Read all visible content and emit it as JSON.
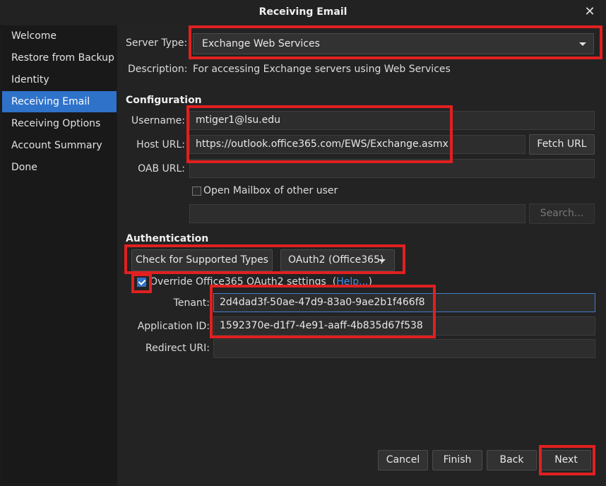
{
  "window": {
    "title": "Receiving Email"
  },
  "sidebar": {
    "items": [
      {
        "label": "Welcome"
      },
      {
        "label": "Restore from Backup"
      },
      {
        "label": "Identity"
      },
      {
        "label": "Receiving Email"
      },
      {
        "label": "Receiving Options"
      },
      {
        "label": "Account Summary"
      },
      {
        "label": "Done"
      }
    ],
    "active_index": 3
  },
  "server": {
    "type_label": "Server Type:",
    "type_value": "Exchange Web Services",
    "description_label": "Description:",
    "description_value": "For accessing Exchange servers using Web Services"
  },
  "configuration": {
    "heading": "Configuration",
    "username_label": "Username:",
    "username_value": "mtiger1@lsu.edu",
    "host_label": "Host URL:",
    "host_value": "https://outlook.office365.com/EWS/Exchange.asmx",
    "fetch_button": "Fetch URL",
    "oab_label": "OAB URL:",
    "oab_value": "",
    "other_mailbox_label": "Open Mailbox of other user",
    "other_mailbox_checked": false,
    "mailbox_value": "",
    "search_button": "Search..."
  },
  "authentication": {
    "heading": "Authentication",
    "check_button": "Check for Supported Types",
    "method_value": "OAuth2 (Office365)",
    "override_label": "Override Office365 OAuth2 settings",
    "override_checked": true,
    "help_open": "(",
    "help_link": "Help...",
    "help_close": ")",
    "tenant_label": "Tenant:",
    "tenant_value": "2d4dad3f-50ae-47d9-83a0-9ae2b1f466f8",
    "appid_label": "Application ID:",
    "appid_value": "1592370e-d1f7-4e91-aaff-4b835d67f538",
    "redirect_label": "Redirect URI:",
    "redirect_value": ""
  },
  "footer": {
    "cancel": "Cancel",
    "finish": "Finish",
    "back": "Back",
    "next": "Next"
  },
  "colors": {
    "accent": "#2f72c9",
    "highlight": "#e02020",
    "background": "#232323"
  },
  "icons": {
    "close": "close-icon",
    "dropdown": "chevron-down-icon"
  }
}
